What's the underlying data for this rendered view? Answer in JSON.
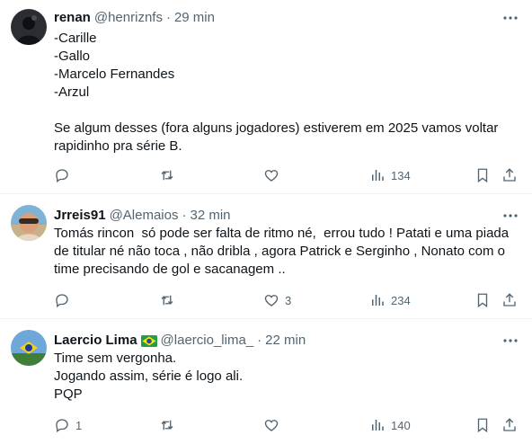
{
  "tweets": [
    {
      "name": "renan",
      "handle": "@henriznfs",
      "separator": "·",
      "time": "29 min",
      "lines": [
        "-Carille",
        "-Gallo",
        "-Marcelo Fernandes",
        "-Arzul",
        "",
        "Se algum desses (fora alguns jogadores) estiverem em 2025 vamos voltar",
        "rapidinho pra série B."
      ],
      "replies": "",
      "retweets": "",
      "likes": "",
      "views": "134",
      "has_flag": false
    },
    {
      "name": "Jrreis91",
      "handle": "@Alemaios",
      "separator": "·",
      "time": "32 min",
      "lines": [
        "Tomás rincon  só pode ser falta de ritmo né,  errou tudo ! Patati e uma piada",
        "de titular né não toca , não dribla , agora Patrick e Serginho , Nonato com o",
        "time precisando de gol e sacanagem .."
      ],
      "replies": "",
      "retweets": "",
      "likes": "3",
      "views": "234",
      "has_flag": false
    },
    {
      "name": "Laercio Lima",
      "handle": "@laercio_lima_",
      "separator": "·",
      "time": "22 min",
      "lines": [
        "Time sem vergonha.",
        "Jogando assim, série é logo ali.",
        "PQP"
      ],
      "replies": "1",
      "retweets": "",
      "likes": "",
      "views": "140",
      "has_flag": true
    }
  ],
  "colors": {
    "text": "#0f1419",
    "secondary": "#536471",
    "divider": "#eff3f4"
  },
  "icons": [
    "more-icon",
    "reply-icon",
    "retweet-icon",
    "like-icon",
    "views-icon",
    "bookmark-icon",
    "share-icon",
    "brazil-flag-icon"
  ]
}
